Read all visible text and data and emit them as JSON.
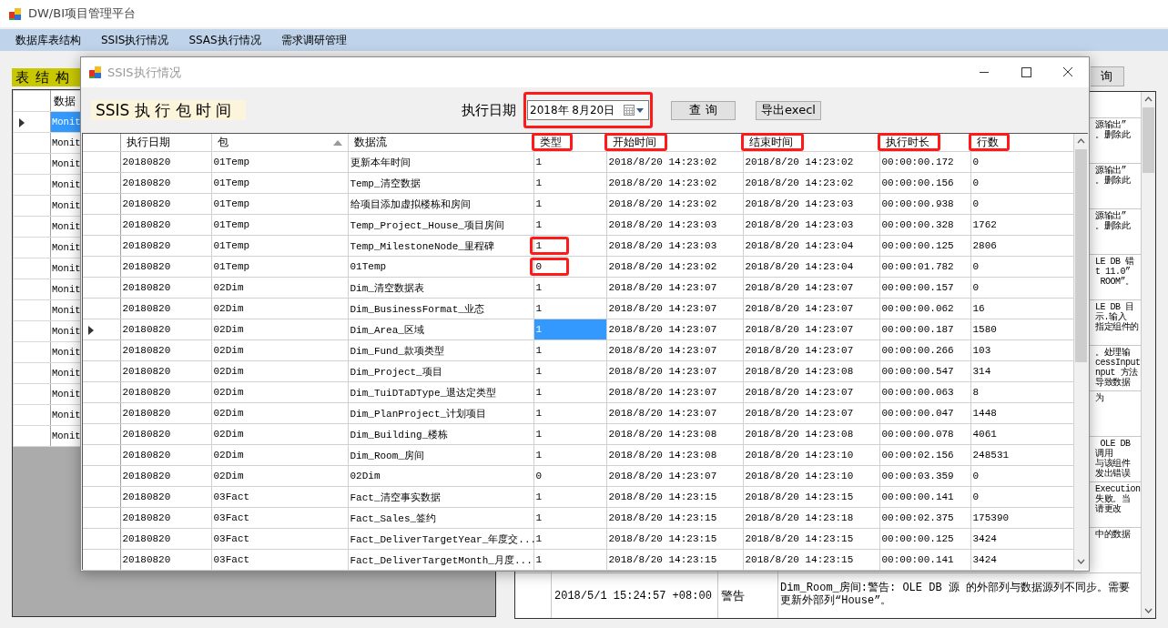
{
  "window": {
    "title": "DW/BI项目管理平台"
  },
  "menu": [
    "数据库表结构",
    "SSIS执行情况",
    "SSAS执行情况",
    "需求调研管理"
  ],
  "left_panel": {
    "title": "表 结 构",
    "grid": {
      "columns": [
        "数据"
      ],
      "rows": [
        {
          "cell": "Monit",
          "selected": true
        },
        {
          "cell": "Monit",
          "selected": false
        },
        {
          "cell": "Monit",
          "selected": false
        },
        {
          "cell": "Monit",
          "selected": false
        },
        {
          "cell": "Monit",
          "selected": false
        },
        {
          "cell": "Monit",
          "selected": false
        },
        {
          "cell": "Monit",
          "selected": false
        },
        {
          "cell": "Monit",
          "selected": false
        },
        {
          "cell": "Monit",
          "selected": false
        },
        {
          "cell": "Monit",
          "selected": false
        },
        {
          "cell": "Monit",
          "selected": false
        },
        {
          "cell": "Monit",
          "selected": false
        },
        {
          "cell": "Monit",
          "selected": false
        },
        {
          "cell": "Monit",
          "selected": false
        },
        {
          "cell": "Monit",
          "selected": false
        },
        {
          "cell": "Monit",
          "selected": false
        }
      ]
    }
  },
  "right_panel": {
    "button": "询",
    "grid": {
      "rows": [
        {
          "lines": [
            "源输出”",
            "。删除此"
          ]
        },
        {
          "lines": [
            "源输出”",
            "。删除此"
          ]
        },
        {
          "lines": [
            "源输出”",
            "。删除此"
          ]
        },
        {
          "lines": [
            "LE DB 错",
            "t 11.0”",
            " ROOM”。"
          ]
        },
        {
          "lines": [
            "LE DB 目",
            "示.输入",
            "指定组件的"
          ]
        },
        {
          "lines": [
            "。处理输",
            "cessInput",
            "nput 方法",
            "导致数据"
          ]
        },
        {
          "lines": [
            "为"
          ]
        },
        {
          "lines": [
            " OLE DB",
            "调用",
            "与该组件",
            "发出错误"
          ]
        },
        {
          "lines": [
            "Execution",
            "失败。当",
            "请更改"
          ]
        },
        {
          "lines": [
            "中的数据"
          ]
        },
        {
          "time": "2018/5/1 15:24:57 +08:00",
          "level": "警告",
          "message": "Dim_Room_房间:警告: OLE DB 源 的外部列与数据源列不同步。需要更新外部列“House”。"
        }
      ]
    }
  },
  "dialog": {
    "title": "SSIS执行情况",
    "heading": "SSIS 执 行 包 时 间",
    "date_label": "执行日期",
    "date_picker": {
      "value": "2018年 8月20日",
      "marked": true
    },
    "buttons": [
      "查 询",
      "导出execl"
    ],
    "table": {
      "columns": [
        {
          "label": "执行日期",
          "marked": false,
          "sorted": false
        },
        {
          "label": "包",
          "marked": false,
          "sorted": true
        },
        {
          "label": "数据流",
          "marked": false,
          "sorted": false
        },
        {
          "label": "类型",
          "marked": true,
          "sorted": false
        },
        {
          "label": "开始时间",
          "marked": true,
          "sorted": false
        },
        {
          "label": "结束时间",
          "marked": true,
          "sorted": false
        },
        {
          "label": "执行时长",
          "marked": true,
          "sorted": false
        },
        {
          "label": "行数",
          "marked": true,
          "sorted": false
        }
      ],
      "rows": [
        {
          "date": "20180820",
          "package": "01Temp",
          "data_flow": "更新本年时间",
          "type": "1",
          "start_time": "2018/8/20 14:23:02",
          "end_time": "2018/8/20 14:23:02",
          "duration": "00:00:00.172",
          "row_count": "0",
          "selected": false,
          "marked": false
        },
        {
          "date": "20180820",
          "package": "01Temp",
          "data_flow": "Temp_清空数据",
          "type": "1",
          "start_time": "2018/8/20 14:23:02",
          "end_time": "2018/8/20 14:23:02",
          "duration": "00:00:00.156",
          "row_count": "0",
          "selected": false,
          "marked": false
        },
        {
          "date": "20180820",
          "package": "01Temp",
          "data_flow": "给项目添加虚拟楼栋和房间",
          "type": "1",
          "start_time": "2018/8/20 14:23:02",
          "end_time": "2018/8/20 14:23:03",
          "duration": "00:00:00.938",
          "row_count": "0",
          "selected": false,
          "marked": false
        },
        {
          "date": "20180820",
          "package": "01Temp",
          "data_flow": "Temp_Project_House_项目房间",
          "type": "1",
          "start_time": "2018/8/20 14:23:03",
          "end_time": "2018/8/20 14:23:03",
          "duration": "00:00:00.328",
          "row_count": "1762",
          "selected": false,
          "marked": false
        },
        {
          "date": "20180820",
          "package": "01Temp",
          "data_flow": "Temp_MilestoneNode_里程碑",
          "type": "1",
          "start_time": "2018/8/20 14:23:03",
          "end_time": "2018/8/20 14:23:04",
          "duration": "00:00:00.125",
          "row_count": "2806",
          "selected": false,
          "marked": true
        },
        {
          "date": "20180820",
          "package": "01Temp",
          "data_flow": "01Temp",
          "type": "0",
          "start_time": "2018/8/20 14:23:02",
          "end_time": "2018/8/20 14:23:04",
          "duration": "00:00:01.782",
          "row_count": "0",
          "selected": false,
          "marked": true
        },
        {
          "date": "20180820",
          "package": "02Dim",
          "data_flow": "Dim_清空数据表",
          "type": "1",
          "start_time": "2018/8/20 14:23:07",
          "end_time": "2018/8/20 14:23:07",
          "duration": "00:00:00.157",
          "row_count": "0",
          "selected": false,
          "marked": false
        },
        {
          "date": "20180820",
          "package": "02Dim",
          "data_flow": "Dim_BusinessFormat_业态",
          "type": "1",
          "start_time": "2018/8/20 14:23:07",
          "end_time": "2018/8/20 14:23:07",
          "duration": "00:00:00.062",
          "row_count": "16",
          "selected": false,
          "marked": false
        },
        {
          "date": "20180820",
          "package": "02Dim",
          "data_flow": "Dim_Area_区域",
          "type": "1",
          "start_time": "2018/8/20 14:23:07",
          "end_time": "2018/8/20 14:23:07",
          "duration": "00:00:00.187",
          "row_count": "1580",
          "selected": true,
          "marked": false
        },
        {
          "date": "20180820",
          "package": "02Dim",
          "data_flow": "Dim_Fund_款项类型",
          "type": "1",
          "start_time": "2018/8/20 14:23:07",
          "end_time": "2018/8/20 14:23:07",
          "duration": "00:00:00.266",
          "row_count": "103",
          "selected": false,
          "marked": false
        },
        {
          "date": "20180820",
          "package": "02Dim",
          "data_flow": "Dim_Project_项目",
          "type": "1",
          "start_time": "2018/8/20 14:23:07",
          "end_time": "2018/8/20 14:23:08",
          "duration": "00:00:00.547",
          "row_count": "314",
          "selected": false,
          "marked": false
        },
        {
          "date": "20180820",
          "package": "02Dim",
          "data_flow": "Dim_TuiDTaDType_退达定类型",
          "type": "1",
          "start_time": "2018/8/20 14:23:07",
          "end_time": "2018/8/20 14:23:07",
          "duration": "00:00:00.063",
          "row_count": "8",
          "selected": false,
          "marked": false
        },
        {
          "date": "20180820",
          "package": "02Dim",
          "data_flow": "Dim_PlanProject_计划项目",
          "type": "1",
          "start_time": "2018/8/20 14:23:07",
          "end_time": "2018/8/20 14:23:07",
          "duration": "00:00:00.047",
          "row_count": "1448",
          "selected": false,
          "marked": false
        },
        {
          "date": "20180820",
          "package": "02Dim",
          "data_flow": "Dim_Building_楼栋",
          "type": "1",
          "start_time": "2018/8/20 14:23:08",
          "end_time": "2018/8/20 14:23:08",
          "duration": "00:00:00.078",
          "row_count": "4061",
          "selected": false,
          "marked": false
        },
        {
          "date": "20180820",
          "package": "02Dim",
          "data_flow": "Dim_Room_房间",
          "type": "1",
          "start_time": "2018/8/20 14:23:08",
          "end_time": "2018/8/20 14:23:10",
          "duration": "00:00:02.156",
          "row_count": "248531",
          "selected": false,
          "marked": false
        },
        {
          "date": "20180820",
          "package": "02Dim",
          "data_flow": "02Dim",
          "type": "0",
          "start_time": "2018/8/20 14:23:07",
          "end_time": "2018/8/20 14:23:10",
          "duration": "00:00:03.359",
          "row_count": "0",
          "selected": false,
          "marked": false
        },
        {
          "date": "20180820",
          "package": "03Fact",
          "data_flow": "Fact_清空事实数据",
          "type": "1",
          "start_time": "2018/8/20 14:23:15",
          "end_time": "2018/8/20 14:23:15",
          "duration": "00:00:00.141",
          "row_count": "0",
          "selected": false,
          "marked": false
        },
        {
          "date": "20180820",
          "package": "03Fact",
          "data_flow": "Fact_Sales_签约",
          "type": "1",
          "start_time": "2018/8/20 14:23:15",
          "end_time": "2018/8/20 14:23:18",
          "duration": "00:00:02.375",
          "row_count": "175390",
          "selected": false,
          "marked": false
        },
        {
          "date": "20180820",
          "package": "03Fact",
          "data_flow": "Fact_DeliverTargetYear_年度交...",
          "type": "1",
          "start_time": "2018/8/20 14:23:15",
          "end_time": "2018/8/20 14:23:15",
          "duration": "00:00:00.125",
          "row_count": "3424",
          "selected": false,
          "marked": false
        },
        {
          "date": "20180820",
          "package": "03Fact",
          "data_flow": "Fact_DeliverTargetMonth_月度...",
          "type": "1",
          "start_time": "2018/8/20 14:23:15",
          "end_time": "2018/8/20 14:23:15",
          "duration": "00:00:00.141",
          "row_count": "3424",
          "selected": false,
          "marked": false
        }
      ]
    }
  }
}
